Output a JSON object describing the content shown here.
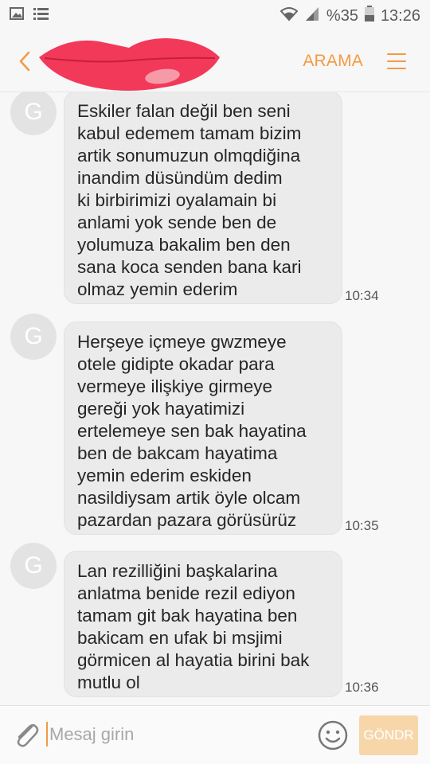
{
  "status_bar": {
    "battery": "%35",
    "time": "13:26"
  },
  "header": {
    "search_label": "ARAMA"
  },
  "messages": [
    {
      "avatar": "G",
      "lines": [
        "Eskiler falan değil ben seni",
        "kabul edemem tamam bizim",
        "artik sonumuzun olmqdiğina",
        "inandim düsündüm dedim",
        "ki birbirimizi oyalamain bi",
        "anlami yok sende ben de",
        "yolumuza bakalim ben den",
        "sana koca senden bana kari",
        "olmaz yemin ederim"
      ],
      "time": "10:34"
    },
    {
      "avatar": "G",
      "lines": [
        "Herşeye içmeye gwzmeye",
        "otele gidipte okadar para",
        "vermeye ilişkiye girmeye",
        "gereği yok hayatimizi",
        "ertelemeye sen bak hayatina",
        "ben de bakcam hayatima",
        "yemin ederim eskiden",
        "nasildiysam artik öyle olcam",
        "pazardan pazara görüsürüz"
      ],
      "time": "10:35"
    },
    {
      "avatar": "G",
      "lines": [
        "Lan rezilliğini başkalarina",
        "anlatma benide rezil ediyon",
        "tamam git bak hayatina ben",
        "bakicam en ufak bi msjimi",
        "görmicen al hayatia birini bak",
        "mutlu ol"
      ],
      "time": "10:36"
    }
  ],
  "composer": {
    "placeholder": "Mesaj girin",
    "send_label": "GÖNDR"
  },
  "colors": {
    "accent": "#f39a45",
    "bubble": "#ebebeb",
    "send_disabled": "#f7d6aa",
    "redaction": "#f2395a"
  },
  "icons": [
    "image-icon",
    "list-icon",
    "wifi-icon",
    "signal-icon",
    "battery-icon",
    "back-icon",
    "menu-icon",
    "paperclip-icon",
    "emoji-icon"
  ]
}
